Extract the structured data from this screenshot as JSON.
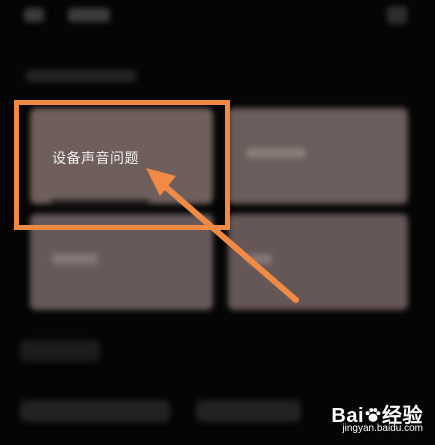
{
  "main": {
    "cards": [
      {
        "label": "设备声音问题"
      }
    ]
  },
  "watermark": {
    "brand_prefix": "Bai",
    "brand_suffix": "经验",
    "site": "jingyan.baidu.com"
  },
  "colors": {
    "highlight": "#f08a45",
    "card": "#6a5a58",
    "background": "#050505"
  },
  "icons": [
    "baidu-paw-icon",
    "arrow-icon"
  ]
}
